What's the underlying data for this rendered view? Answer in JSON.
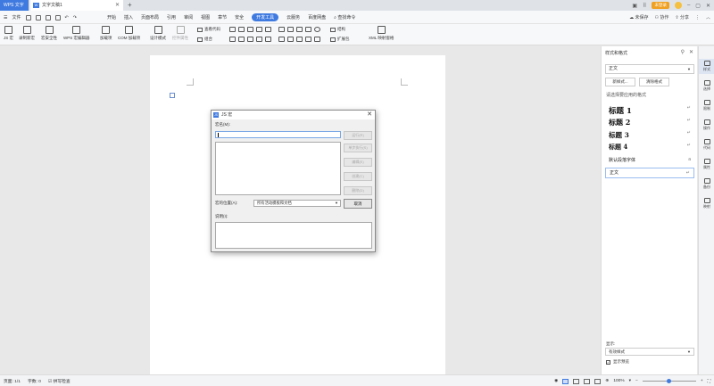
{
  "tabs": {
    "wps_label": "WPS 文字",
    "doc_label": "文字文稿1",
    "doc_icon": "W",
    "login_label": "未登录"
  },
  "menubar": {
    "file_label": "文件",
    "tabs": [
      "开始",
      "插入",
      "页面布局",
      "引用",
      "审阅",
      "视图",
      "章节",
      "安全",
      "开发工具",
      "云服务",
      "百度网盘"
    ],
    "active_tab": "开发工具",
    "search_label": "查找命令",
    "unsynced_label": "未保存",
    "collab_label": "协作",
    "share_label": "分享"
  },
  "ribbon": {
    "big_buttons": [
      "JS 宏",
      "录制新宏",
      "宏安全性",
      "WPS 宏编辑器",
      "加载项",
      "COM 加载项",
      "设计模式"
    ],
    "control_props": "控件属性",
    "view_code": "查看代码",
    "combine": "组合",
    "structure": "结构",
    "expand_props": "扩展包",
    "xml_mapping": "XML 映射窗格"
  },
  "dialog": {
    "icon": "JS",
    "title": "JS 宏",
    "name_label": "宏名(M):",
    "name_value": "",
    "buttons": [
      "运行(R)",
      "单步执行(S)",
      "编辑(E)",
      "创建(C)",
      "删除(D)"
    ],
    "location_label": "宏的位置(A):",
    "location_value": "所有活动模板和文档",
    "cancel_label": "取消",
    "description_label": "说明(I):",
    "description_value": ""
  },
  "panel": {
    "title": "样式和格式",
    "current_style": "正文",
    "new_style_btn": "新样式...",
    "clear_format_btn": "清除格式",
    "apply_label": "请选择要应用的格式",
    "styles": [
      {
        "name": "标题 1",
        "size": "heading"
      },
      {
        "name": "标题 2",
        "size": "heading"
      },
      {
        "name": "标题 3",
        "size": "heading"
      },
      {
        "name": "标题 4",
        "size": "heading"
      },
      {
        "name": "默认段落字体",
        "size": "small"
      },
      {
        "name": "正文",
        "size": "small"
      }
    ],
    "show_label": "显示:",
    "show_value": "有效样式",
    "preview_label": "显示预览",
    "preview_checked": true
  },
  "sidebar": {
    "items": [
      "样式",
      "选择",
      "限制",
      "操作",
      "代码",
      "属性",
      "备份",
      "映射"
    ],
    "active": "样式"
  },
  "status": {
    "page": "页面: 1/1",
    "words": "字数: 0",
    "spellcheck": "拼写检查",
    "zoom": "100%",
    "zoom_level": 0.5
  }
}
